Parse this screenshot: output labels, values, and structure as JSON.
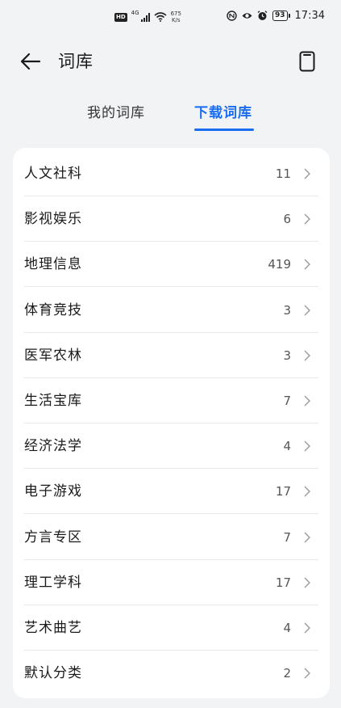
{
  "status_bar": {
    "hd": "HD",
    "signal_type": "4G",
    "net_speed_value": "675",
    "net_speed_unit": "K/s",
    "battery": "93",
    "time": "17:34"
  },
  "header": {
    "title": "词库",
    "back_icon": "arrow-left-icon",
    "action_icon": "phone-icon"
  },
  "tabs": [
    {
      "label": "我的词库",
      "active": false
    },
    {
      "label": "下载词库",
      "active": true
    }
  ],
  "categories": [
    {
      "label": "人文社科",
      "count": "11"
    },
    {
      "label": "影视娱乐",
      "count": "6"
    },
    {
      "label": "地理信息",
      "count": "419"
    },
    {
      "label": "体育竞技",
      "count": "3"
    },
    {
      "label": "医军农林",
      "count": "3"
    },
    {
      "label": "生活宝库",
      "count": "7"
    },
    {
      "label": "经济法学",
      "count": "4"
    },
    {
      "label": "电子游戏",
      "count": "17"
    },
    {
      "label": "方言专区",
      "count": "7"
    },
    {
      "label": "理工学科",
      "count": "17"
    },
    {
      "label": "艺术曲艺",
      "count": "4"
    },
    {
      "label": "默认分类",
      "count": "2"
    }
  ],
  "colors": {
    "accent": "#1a6cf0",
    "background": "#f1f3f5",
    "card": "#ffffff"
  }
}
